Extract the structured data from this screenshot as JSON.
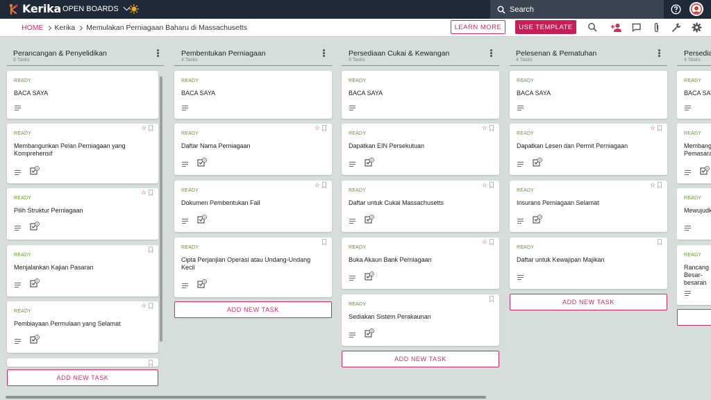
{
  "app": {
    "brand": "Kerika",
    "open_boards": "OPEN BOARDS",
    "search_placeholder": "Search"
  },
  "breadcrumb": {
    "home": "HOME",
    "account": "Kerika",
    "board": "Memulakan Perniagaan Baharu di Massachusetts"
  },
  "toolbar": {
    "learn_more": "LEARN MORE",
    "use_template": "USE TEMPLATE",
    "icons": [
      "search-icon",
      "add-person-icon",
      "chat-icon",
      "attachment-icon",
      "tools-icon",
      "settings-icon"
    ]
  },
  "colors": {
    "accent": "#d02b5a",
    "topbar": "#1f2a38",
    "ready": "#5a9e1e",
    "board_bg": "#d5dedb"
  },
  "add_task_label": "ADD NEW TASK",
  "columns": [
    {
      "title": "Perancangan & Penyelidikan",
      "count": "6 Tasks",
      "cards": [
        {
          "status": "READY",
          "title": "BACA SAYA",
          "badge": ""
        },
        {
          "status": "READY",
          "title": "Membangunkan Pelan Perniagaan yang Komprehensif",
          "badge": "4"
        },
        {
          "status": "READY",
          "title": "Pilih Struktur Perniagaan",
          "badge": "4"
        },
        {
          "status": "READY",
          "title": "Menjalankan Kajian Pasaran",
          "badge": "5"
        },
        {
          "status": "READY",
          "title": "Pembiayaan Permulaan yang Selamat",
          "badge": "4"
        }
      ]
    },
    {
      "title": "Pembentukan Perniagaan",
      "count": "4 Tasks",
      "cards": [
        {
          "status": "READY",
          "title": "BACA SAYA",
          "badge": ""
        },
        {
          "status": "READY",
          "title": "Daftar Nama Perniagaan",
          "badge": "3"
        },
        {
          "status": "READY",
          "title": "Dokumen Pembentukan Fail",
          "badge": "4"
        },
        {
          "status": "READY",
          "title": "Cipta Perjanjian Operasi atau Undang-Undang Kecil",
          "badge": "3"
        }
      ]
    },
    {
      "title": "Persediaan Cukai & Kewangan",
      "count": "5 Tasks",
      "cards": [
        {
          "status": "READY",
          "title": "BACA SAYA",
          "badge": ""
        },
        {
          "status": "READY",
          "title": "Dapatkan EIN Persekutuan",
          "badge": "2"
        },
        {
          "status": "READY",
          "title": "Daftar untuk Cukai Massachusetts",
          "badge": "3"
        },
        {
          "status": "READY",
          "title": "Buka Akaun Bank Perniagaan",
          "badge": "3"
        },
        {
          "status": "READY",
          "title": "Sediakan Sistem Perakaunan",
          "badge": "3"
        }
      ]
    },
    {
      "title": "Pelesenan & Pematuhan",
      "count": "4 Tasks",
      "cards": [
        {
          "status": "READY",
          "title": "BACA SAYA",
          "badge": ""
        },
        {
          "status": "READY",
          "title": "Dapatkan Lesen dan Permit Perniagaan",
          "badge": "3"
        },
        {
          "status": "READY",
          "title": "Insurans Perniagaan Selamat",
          "badge": "3"
        },
        {
          "status": "READY",
          "title": "Daftar untuk Kewajipan Majikan",
          "badge": ""
        }
      ]
    },
    {
      "title": "Persediaan",
      "count": "4 Tasks",
      "cards": [
        {
          "status": "READY",
          "title": "BACA SAYA",
          "badge": ""
        },
        {
          "status": "READY",
          "title": "Membangunkan Pemasaran",
          "badge": "5"
        },
        {
          "status": "READY",
          "title": "Mewujudkan",
          "badge": ""
        },
        {
          "status": "READY",
          "title": "Rancang Besar-besaran",
          "badge": ""
        }
      ]
    }
  ]
}
